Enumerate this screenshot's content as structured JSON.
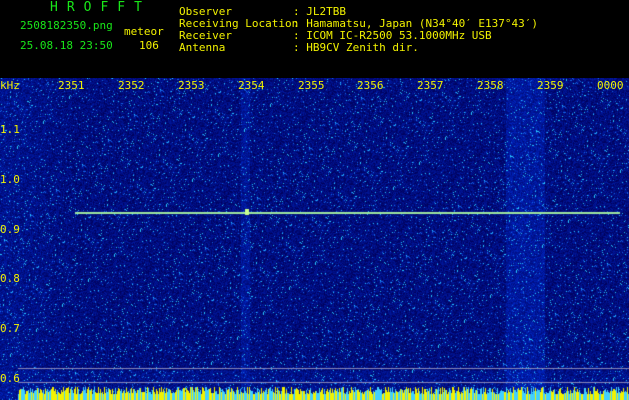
{
  "header": {
    "title": "HROFFT",
    "filename": "2508182350.png",
    "datetime": "25.08.18 23:50",
    "mode": "meteor",
    "count": "106",
    "fields": [
      {
        "label": "Observer",
        "value": ": JL2TBB"
      },
      {
        "label": "Receiving Location",
        "value": ": Hamamatsu, Japan (N34°40′ E137°43′)"
      },
      {
        "label": "Receiver",
        "value": ": ICOM IC-R2500 53.1000MHz USB"
      },
      {
        "label": "Antenna",
        "value": ": HB9CV Zenith dir."
      }
    ]
  },
  "axes": {
    "y_unit": "kHz",
    "x_ticks": [
      "2351",
      "2352",
      "2353",
      "2354",
      "2355",
      "2356",
      "2357",
      "2358",
      "2359",
      "0000"
    ],
    "y_ticks": [
      "1.1",
      "1.0",
      "0.9",
      "0.8",
      "0.7",
      "0.6"
    ]
  },
  "colors": {
    "background": "#000000",
    "header_text_green": "#19e619",
    "header_text_yellow": "#f2f200",
    "spectrum_base": "#0a1a8c",
    "echo_line": "#9fe89f"
  }
}
